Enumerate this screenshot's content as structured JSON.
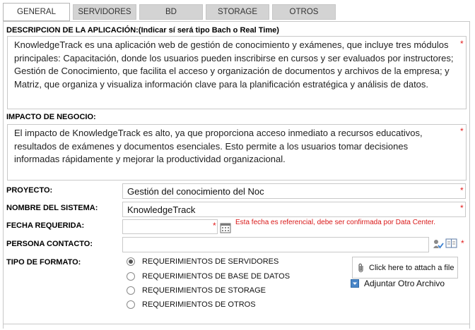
{
  "tabs": [
    {
      "label": "GENERAL",
      "active": true
    },
    {
      "label": "SERVIDORES",
      "active": false
    },
    {
      "label": "BD",
      "active": false
    },
    {
      "label": "STORAGE",
      "active": false
    },
    {
      "label": "OTROS",
      "active": false
    }
  ],
  "descripcion": {
    "label": "DESCRIPCION DE LA APLICACIÓN:(Indicar sí será tipo Bach o Real Time)",
    "value": "KnowledgeTrack es una aplicación web de gestión de conocimiento y exámenes, que incluye tres módulos principales: Capacitación, donde los usuarios pueden inscribirse en cursos y ser evaluados por instructores; Gestión de Conocimiento, que facilita el acceso y organización de documentos y archivos de la empresa; y Matriz, que organiza y visualiza información clave para la planificación estratégica y análisis de datos."
  },
  "impacto": {
    "label": "IMPACTO DE NEGOCIO:",
    "value": "El impacto de KnowledgeTrack es alto, ya que proporciona acceso inmediato a recursos educativos, resultados de exámenes y documentos esenciales. Esto permite a los usuarios tomar decisiones informadas rápidamente y mejorar la productividad organizacional."
  },
  "proyecto": {
    "label": "PROYECTO:",
    "value": "Gestión del conocimiento  del Noc"
  },
  "sistema": {
    "label": "NOMBRE DEL SISTEMA:",
    "value": "KnowledgeTrack"
  },
  "fecha": {
    "label": "FECHA REQUERIDA:",
    "value": "",
    "note": "Esta fecha es referencial, debe ser confirmada por Data Center."
  },
  "contacto": {
    "label": "PERSONA CONTACTO:",
    "value": ""
  },
  "formato": {
    "label": "TIPO DE FORMATO:",
    "options": [
      {
        "label": "REQUERIMIENTOS DE SERVIDORES",
        "checked": true
      },
      {
        "label": "REQUERIMIENTOS DE BASE DE DATOS",
        "checked": false
      },
      {
        "label": "REQUERIMIENTOS DE STORAGE",
        "checked": false
      },
      {
        "label": "REQUERIMIENTOS DE OTROS",
        "checked": false
      }
    ]
  },
  "attach": {
    "label": "Click here to attach a file",
    "otro": "Adjuntar Otro Archivo"
  },
  "required_mark": "*",
  "colors": {
    "required": "#e31c1c",
    "tab_inactive": "#d3d3d3",
    "border": "#c8c8c8"
  },
  "icons": [
    "calendar-icon",
    "user-check-icon",
    "address-book-icon",
    "paperclip-icon",
    "add-file-icon"
  ]
}
